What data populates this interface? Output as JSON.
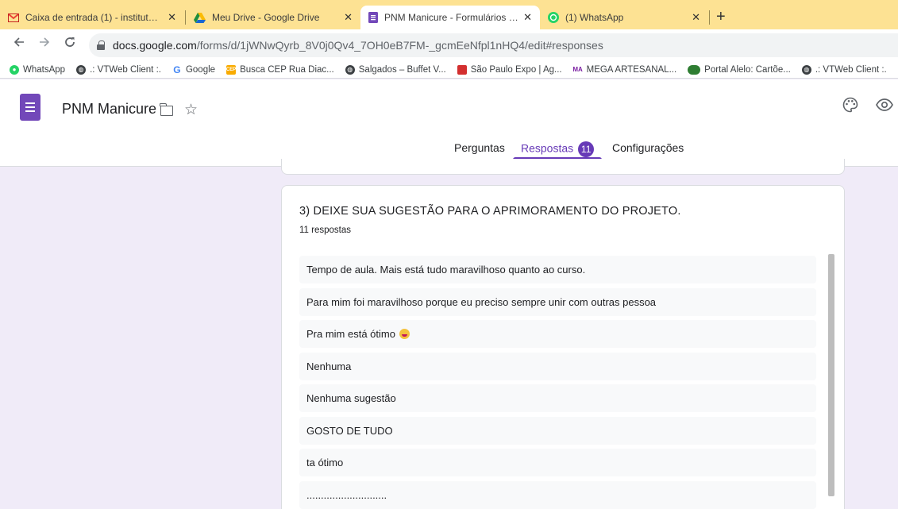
{
  "browser": {
    "tabs": [
      {
        "title": "Caixa de entrada (1) - institutoluc",
        "icon": "gmail-icon",
        "active": false
      },
      {
        "title": "Meu Drive - Google Drive",
        "icon": "drive-icon",
        "active": false
      },
      {
        "title": "PNM Manicure - Formulários Go",
        "icon": "forms-icon",
        "active": true
      },
      {
        "title": "(1) WhatsApp",
        "icon": "whatsapp-icon",
        "active": false
      }
    ],
    "close_glyph": "✕",
    "new_tab_glyph": "+",
    "url_host": "docs.google.com",
    "url_path": "/forms/d/1jWNwQyrb_8V0j0Qv4_7OH0eB7FM-_gcmEeNfpl1nHQ4/edit#responses",
    "bookmarks": [
      {
        "label": "WhatsApp",
        "icon": "whatsapp-icon",
        "color": "#25d366"
      },
      {
        "label": ".: VTWeb Client :.",
        "icon": "globe-icon",
        "color": "#3c4043"
      },
      {
        "label": "Google",
        "icon": "google-icon",
        "color": "#4285f4"
      },
      {
        "label": "Busca CEP Rua Diac...",
        "icon": "cep-icon",
        "color": "#f9ab00"
      },
      {
        "label": "Salgados – Buffet V...",
        "icon": "globe-icon",
        "color": "#3c4043"
      },
      {
        "label": "São Paulo Expo | Ag...",
        "icon": "expo-icon",
        "color": "#d32f2f"
      },
      {
        "label": "MEGA ARTESANAL...",
        "icon": "mega-icon",
        "color": "#7b1fa2"
      },
      {
        "label": "Portal Alelo: Cartõe...",
        "icon": "alelo-icon",
        "color": "#2e7d32"
      },
      {
        "label": ".: VTWeb Client :.",
        "icon": "globe-icon",
        "color": "#3c4043"
      }
    ]
  },
  "form": {
    "title": "PNM Manicure",
    "tabs": {
      "questions": "Perguntas",
      "responses": "Respostas",
      "responses_count": "11",
      "settings": "Configurações"
    },
    "question": {
      "title": "3) DEIXE SUA SUGESTÃO PARA O APRIMORAMENTO DO PROJETO.",
      "count": "11 respostas",
      "answers": [
        "Tempo de aula. Mais está tudo maravilhoso quanto ao curso.",
        "Para mim foi maravilhoso porque eu preciso sempre unir com outras pessoa",
        "Pra mim está ótimo",
        "Nenhuma",
        "Nenhuma sugestão",
        "GOSTO DE TUDO",
        "ta ótimo",
        "............................"
      ]
    }
  },
  "colors": {
    "accent": "#673ab7",
    "tabstrip": "#fde293",
    "page_bg": "#f0ebf8"
  }
}
